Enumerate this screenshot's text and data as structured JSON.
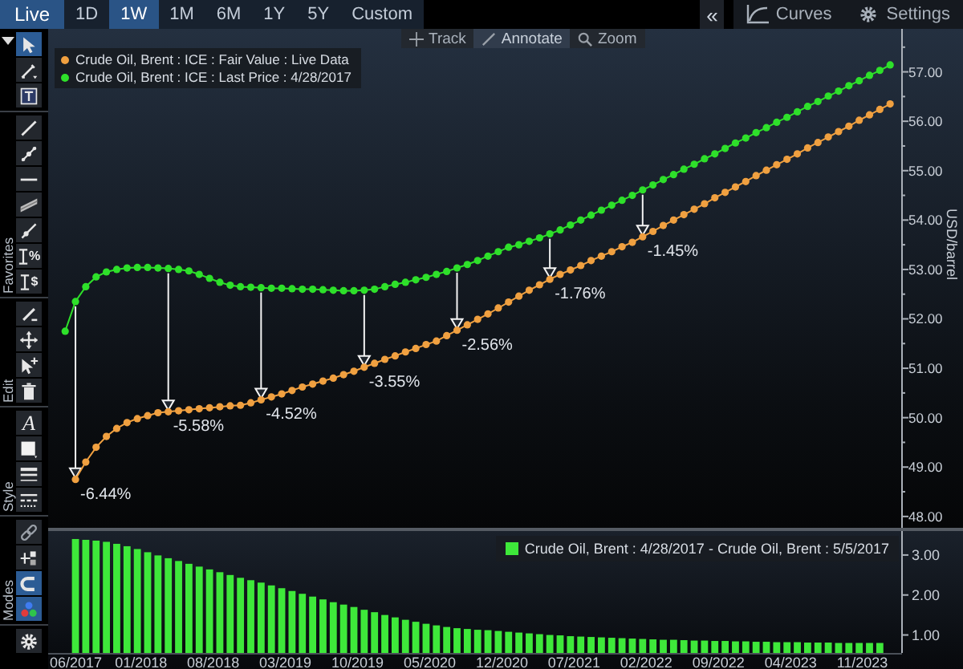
{
  "top_bar": {
    "live": {
      "label": "Live",
      "on": true
    },
    "tabs": [
      {
        "label": "1D",
        "selected": false
      },
      {
        "label": "1W",
        "selected": true
      },
      {
        "label": "1M",
        "selected": false
      },
      {
        "label": "6M",
        "selected": false
      },
      {
        "label": "1Y",
        "selected": false
      },
      {
        "label": "5Y",
        "selected": false
      },
      {
        "label": "Custom",
        "selected": false
      }
    ],
    "collapse": {
      "label": "«"
    },
    "curves": {
      "label": "Curves"
    },
    "settings": {
      "label": "Settings"
    }
  },
  "toolbar": {
    "sections": [
      {
        "tools": [
          {
            "kind": "pointer",
            "selected": true
          },
          {
            "kind": "pen",
            "selected": false
          },
          {
            "kind": "text-box",
            "selected": false
          }
        ]
      },
      {
        "label": "Favorites",
        "tools": [
          {
            "kind": "line",
            "selected": false
          },
          {
            "kind": "line-nodes",
            "selected": false
          },
          {
            "kind": "horizontal-line",
            "selected": false
          },
          {
            "kind": "channel",
            "selected": false
          },
          {
            "kind": "ray",
            "selected": false
          },
          {
            "kind": "fib",
            "glyph": "%",
            "selected": false
          },
          {
            "kind": "fib",
            "glyph": "$",
            "selected": false
          }
        ]
      },
      {
        "label": "Edit",
        "tools": [
          {
            "kind": "pencil",
            "selected": false
          },
          {
            "kind": "move",
            "selected": false
          },
          {
            "kind": "select-add",
            "selected": false
          },
          {
            "kind": "trash",
            "selected": false
          }
        ]
      },
      {
        "label": "Style",
        "tools": [
          {
            "kind": "font",
            "glyph": "A",
            "selected": false
          },
          {
            "kind": "fill",
            "selected": false
          },
          {
            "kind": "line-width",
            "selected": false
          },
          {
            "kind": "line-style",
            "selected": false
          }
        ]
      },
      {
        "label": "Modes",
        "tools": [
          {
            "kind": "link",
            "selected": false
          },
          {
            "kind": "nodes",
            "selected": false
          },
          {
            "kind": "magnet",
            "selected": true
          },
          {
            "kind": "colors",
            "selected": true
          }
        ]
      },
      {
        "tools": [
          {
            "kind": "settings",
            "selected": false
          }
        ]
      }
    ]
  },
  "chart_toolbar": [
    {
      "kind": "track",
      "label": "Track",
      "selected": false
    },
    {
      "kind": "annotate",
      "label": "Annotate",
      "selected": true
    },
    {
      "kind": "zoom",
      "label": "Zoom",
      "selected": false
    }
  ],
  "main_chart": {
    "chart_data": {
      "type": "line",
      "ylabel": "USD/barrel",
      "series": [
        {
          "name": "Crude Oil, Brent : ICE : Fair Value : Live Data",
          "color": "#f0a040",
          "marker": "circle",
          "values": [
            null,
            48.75,
            49.1,
            49.4,
            49.62,
            49.78,
            49.9,
            49.98,
            50.04,
            50.1,
            50.12,
            50.14,
            50.16,
            50.18,
            50.2,
            50.22,
            50.24,
            50.25,
            50.3,
            50.36,
            50.42,
            50.48,
            50.55,
            50.62,
            50.68,
            50.74,
            50.8,
            50.87,
            50.94,
            51.02,
            51.1,
            51.18,
            51.25,
            51.33,
            51.4,
            51.48,
            51.55,
            51.66,
            51.77,
            51.88,
            51.99,
            52.1,
            52.22,
            52.34,
            52.46,
            52.58,
            52.69,
            52.8,
            52.9,
            52.99,
            53.08,
            53.18,
            53.27,
            53.36,
            53.46,
            53.55,
            53.66,
            53.77,
            53.89,
            54.0,
            54.11,
            54.22,
            54.33,
            54.45,
            54.56,
            54.67,
            54.78,
            54.9,
            55.01,
            55.12,
            55.23,
            55.34,
            55.46,
            55.57,
            55.68,
            55.79,
            55.9,
            56.02,
            56.13,
            56.24,
            56.35
          ]
        },
        {
          "name": "Crude Oil, Brent : ICE : Last Price : 4/28/2017",
          "color": "#2ee02a",
          "marker": "circle",
          "values": [
            51.75,
            52.35,
            52.65,
            52.85,
            52.95,
            53.0,
            53.03,
            53.04,
            53.04,
            53.03,
            53.02,
            53.0,
            52.97,
            52.9,
            52.82,
            52.74,
            52.68,
            52.65,
            52.64,
            52.63,
            52.62,
            52.62,
            52.61,
            52.6,
            52.6,
            52.59,
            52.58,
            52.57,
            52.57,
            52.58,
            52.6,
            52.65,
            52.7,
            52.74,
            52.79,
            52.84,
            52.9,
            52.96,
            53.03,
            53.1,
            53.18,
            53.27,
            53.36,
            53.45,
            53.5,
            53.57,
            53.64,
            53.72,
            53.8,
            53.9,
            54.0,
            54.1,
            54.2,
            54.3,
            54.4,
            54.5,
            54.61,
            54.71,
            54.82,
            54.92,
            55.03,
            55.13,
            55.24,
            55.34,
            55.45,
            55.56,
            55.66,
            55.77,
            55.87,
            55.98,
            56.08,
            56.19,
            56.3,
            56.4,
            56.51,
            56.61,
            56.72,
            56.82,
            56.93,
            57.03,
            57.14
          ]
        }
      ],
      "ylim": [
        47.77,
        57.87
      ],
      "yticks": [
        {
          "value": 48,
          "label": "48.00"
        },
        {
          "value": 49,
          "label": "49.00"
        },
        {
          "value": 50,
          "label": "50.00"
        },
        {
          "value": 51,
          "label": "51.00"
        },
        {
          "value": 52,
          "label": "52.00"
        },
        {
          "value": 53,
          "label": "53.00"
        },
        {
          "value": 54,
          "label": "54.00"
        },
        {
          "value": 55,
          "label": "55.00"
        },
        {
          "value": 56,
          "label": "56.00"
        },
        {
          "value": 57,
          "label": "57.00"
        }
      ],
      "annotations": [
        "-6.44%",
        "-5.58%",
        "-4.52%",
        "-3.55%",
        "-2.56%",
        "-1.76%",
        "-1.45%"
      ]
    }
  },
  "spread_chart": {
    "chart_data": {
      "type": "bar",
      "categories": [
        "06/2017",
        null,
        null,
        null,
        null,
        null,
        null,
        "01/2018",
        null,
        null,
        null,
        null,
        null,
        null,
        "08/2018",
        null,
        null,
        null,
        null,
        null,
        null,
        "03/2019",
        null,
        null,
        null,
        null,
        null,
        null,
        "10/2019",
        null,
        null,
        null,
        null,
        null,
        null,
        "05/2020",
        null,
        null,
        null,
        null,
        null,
        null,
        "12/2020",
        null,
        null,
        null,
        null,
        null,
        null,
        "07/2021",
        null,
        null,
        null,
        null,
        null,
        null,
        "02/2022",
        null,
        null,
        null,
        null,
        null,
        null,
        "09/2022",
        null,
        null,
        null,
        null,
        null,
        null,
        "04/2023",
        null,
        null,
        null,
        null,
        null,
        null,
        "11/2023",
        null,
        null,
        null
      ],
      "series": [
        {
          "name": "Crude Oil, Brent : 4/28/2017 - Crude Oil, Brent : 5/5/2017",
          "color": "#3ee83a",
          "values": [
            null,
            3.4,
            3.38,
            3.36,
            3.33,
            3.28,
            3.22,
            3.15,
            3.07,
            2.99,
            2.92,
            2.85,
            2.78,
            2.71,
            2.64,
            2.57,
            2.5,
            2.43,
            2.37,
            2.31,
            2.24,
            2.17,
            2.1,
            2.03,
            1.96,
            1.89,
            1.82,
            1.76,
            1.7,
            1.63,
            1.57,
            1.5,
            1.44,
            1.38,
            1.33,
            1.28,
            1.24,
            1.2,
            1.17,
            1.15,
            1.13,
            1.12,
            1.1,
            1.08,
            1.06,
            1.04,
            1.02,
            1.0,
            0.99,
            0.97,
            0.96,
            0.95,
            0.94,
            0.93,
            0.92,
            0.91,
            0.9,
            0.89,
            0.88,
            0.88,
            0.87,
            0.86,
            0.86,
            0.85,
            0.85,
            0.84,
            0.84,
            0.83,
            0.83,
            0.82,
            0.82,
            0.82,
            0.81,
            0.81,
            0.81,
            0.8,
            0.8,
            0.8,
            0.8,
            0.8,
            null
          ]
        }
      ],
      "ylim": [
        0.55,
        3.6
      ],
      "yticks": [
        {
          "value": 1,
          "label": "1.00"
        },
        {
          "value": 2,
          "label": "2.00"
        },
        {
          "value": 3,
          "label": "3.00"
        }
      ]
    }
  }
}
